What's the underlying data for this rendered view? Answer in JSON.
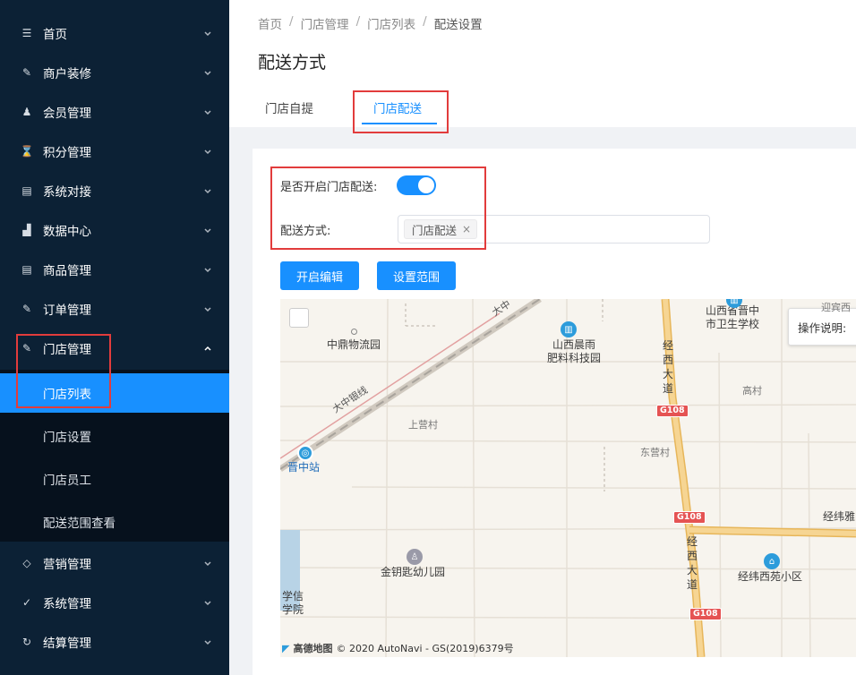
{
  "sidebar": {
    "items": [
      {
        "label": "首页",
        "icon": "list-icon"
      },
      {
        "label": "商户装修",
        "icon": "pen-icon"
      },
      {
        "label": "会员管理",
        "icon": "users-icon"
      },
      {
        "label": "积分管理",
        "icon": "hourglass-icon"
      },
      {
        "label": "系统对接",
        "icon": "document-icon"
      },
      {
        "label": "数据中心",
        "icon": "chart-icon"
      },
      {
        "label": "商品管理",
        "icon": "document-icon"
      },
      {
        "label": "订单管理",
        "icon": "edit-icon"
      },
      {
        "label": "门店管理",
        "icon": "edit-icon"
      },
      {
        "label": "营销管理",
        "icon": "tag-icon"
      },
      {
        "label": "系统管理",
        "icon": "check-circle-icon"
      },
      {
        "label": "结算管理",
        "icon": "refresh-icon"
      }
    ],
    "store_submenu": [
      {
        "label": "门店列表",
        "active": true
      },
      {
        "label": "门店设置",
        "active": false
      },
      {
        "label": "门店员工",
        "active": false
      },
      {
        "label": "配送范围查看",
        "active": false
      }
    ]
  },
  "breadcrumb": [
    "首页",
    "门店管理",
    "门店列表",
    "配送设置"
  ],
  "breadcrumb_sep": "/",
  "page_title": "配送方式",
  "tabs": [
    {
      "label": "门店自提",
      "active": false
    },
    {
      "label": "门店配送",
      "active": true
    }
  ],
  "form": {
    "enable_label": "是否开启门店配送:",
    "enable_value": true,
    "method_label": "配送方式:",
    "method_tag": "门店配送",
    "tag_close": "×"
  },
  "buttons": {
    "edit": "开启编辑",
    "range": "设置范围"
  },
  "map": {
    "labels": {
      "zhongding": "中鼎物流园",
      "shanxi_chenyu": "山西晨雨\n肥料科技园",
      "health_school": "山西省晋中\n市卫生学校",
      "jingxi_road_1": "经西大道",
      "jingxi_road_2": "经西大道",
      "gaocun": "高村",
      "shangying": "上营村",
      "dongying": "东营村",
      "jinzhong_station": "晋中站",
      "jingwei_ya": "经纬雅",
      "golden_key": "金钥匙幼儿园",
      "jingwei_xiyuan": "经纬西苑小区",
      "xuexin": "学信\n学院",
      "railway_1": "大中银线",
      "railway_2": "大中",
      "top_right": "迎宾西"
    },
    "shields": [
      "G108",
      "G108",
      "G108"
    ],
    "info_panel": "操作说明:",
    "copyright_brand": "高德地图",
    "copyright_text": "© 2020 AutoNavi - GS(2019)6379号"
  },
  "colors": {
    "sidebar_bg": "#0c2135",
    "active_blue": "#1890ff",
    "highlight_red": "#e23c3c"
  }
}
